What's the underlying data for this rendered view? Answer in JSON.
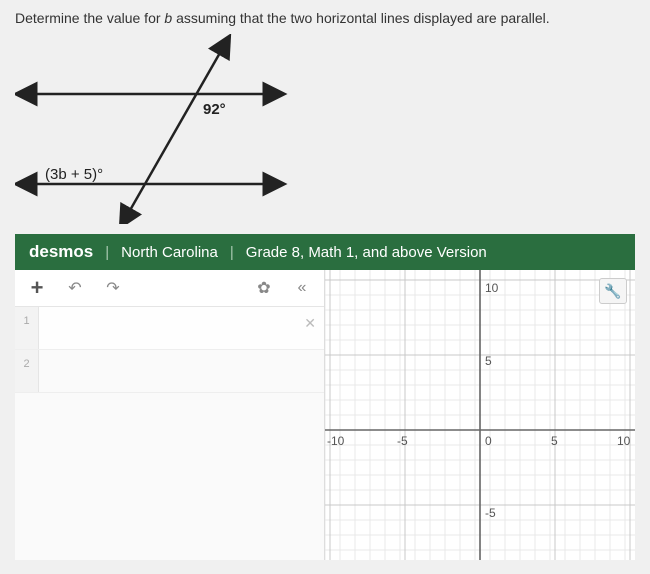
{
  "question": {
    "prefix": "Determine the value for ",
    "var": "b",
    "suffix": " assuming that the two horizontal lines displayed are parallel."
  },
  "diagram": {
    "angle_top": "92°",
    "angle_bottom": "(3b + 5)°"
  },
  "desmos_bar": {
    "brand": "desmos",
    "region": "North Carolina",
    "version": "Grade 8, Math 1, and above Version"
  },
  "toolbar": {
    "plus": "+",
    "undo": "↶",
    "redo": "↷",
    "settings": "✿",
    "collapse": "«"
  },
  "expressions": {
    "row1_num": "1",
    "row1_close": "✕",
    "row2_num": "2"
  },
  "wrench": "🔧",
  "chart_data": {
    "type": "scatter",
    "title": "",
    "xlabel": "",
    "ylabel": "",
    "xlim": [
      -10,
      10
    ],
    "ylim": [
      -10,
      10
    ],
    "x_ticks": [
      -10,
      -5,
      0,
      5,
      10
    ],
    "y_ticks": [
      -5,
      5,
      10
    ],
    "series": []
  },
  "axis_labels": {
    "xm10": "-10",
    "xm5": "-5",
    "x0": "0",
    "x5": "5",
    "x10": "10",
    "ym5": "-5",
    "y5": "5",
    "y10": "10"
  }
}
